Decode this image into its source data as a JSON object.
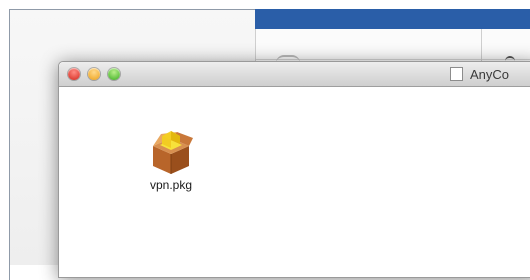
{
  "finder_window": {
    "title": "AnyCo",
    "items": [
      {
        "label": "vpn.pkg",
        "icon": "package-icon"
      }
    ]
  },
  "colors": {
    "window_header_blue": "#2a5ea8",
    "traffic_close": "#e0443a",
    "traffic_minimize": "#f2b13a",
    "traffic_zoom": "#5fc13f"
  }
}
